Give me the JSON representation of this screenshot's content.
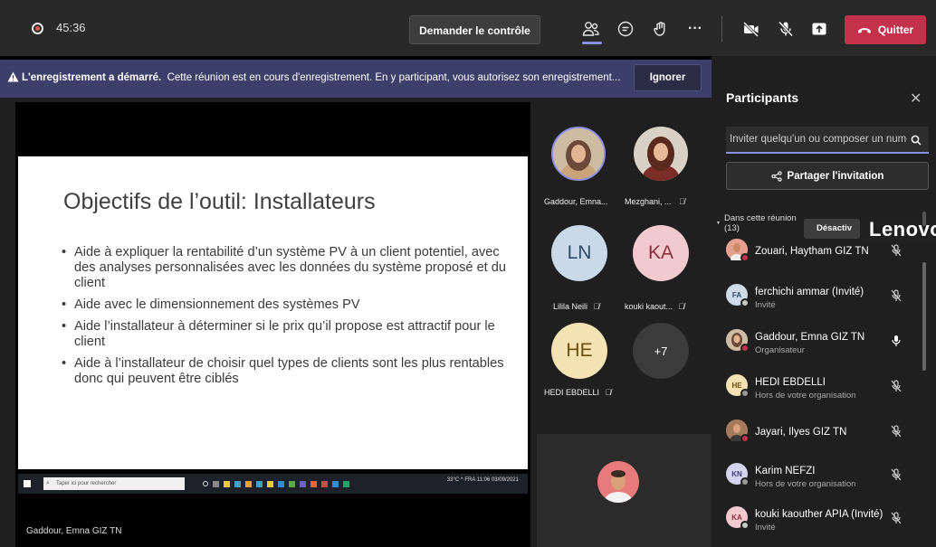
{
  "topbar": {
    "timer": "45:36",
    "request_control": "Demander le contrôle",
    "quit": "Quitter"
  },
  "banner": {
    "title": "L'enregistrement a démarré.",
    "message": "Cette réunion est en cours d'enregistrement. En y participant, vous autorisez son enregistrement...",
    "ignore": "Ignorer"
  },
  "slide": {
    "title": "Objectifs de l’outil: Installateurs",
    "bullets": [
      "Aide à expliquer la rentabilité d’un système PV à un client potentiel, avec des analyses personnalisées avec les données du système proposé et du client",
      "Aide avec le dimensionnement des systèmes PV",
      "Aide l’installateur à déterminer si le prix qu’il propose est attractif pour le client",
      "Aide à l’installateur de choisir quel types de clients sont les plus rentables donc qui peuvent être ciblés"
    ],
    "taskbar_search": "Taper ici pour rechercher",
    "taskbar_tray": "33°C  ^  FRA  11:06 03/09/2021"
  },
  "presenter_name": "Gaddour, Emna GIZ TN",
  "gallery": [
    {
      "name": "Gaddour, Emna...",
      "initials": "",
      "color": "#c9a37a"
    },
    {
      "name": "Mezghani, ...",
      "initials": "",
      "color": "#8c3b2e"
    },
    {
      "name": "Lilila Neili",
      "initials": "LN",
      "color": "#c9d9e8",
      "text": "#2f4a66"
    },
    {
      "name": "kouki kaout...",
      "initials": "KA",
      "color": "#f2c9cf",
      "text": "#8a2f3d"
    },
    {
      "name": "HEDI EBDELLI",
      "initials": "HE",
      "color": "#f5e2b3",
      "text": "#6b4f0e"
    },
    {
      "name": "",
      "initials": "+7",
      "color": "#3b3b3b",
      "text": "#ffffff"
    }
  ],
  "panel": {
    "title": "Participants",
    "invite_placeholder": "Inviter quelqu'un ou composer un numéro",
    "share_invite": "Partager l'invitation",
    "section": "Dans cette réunion (13)",
    "section_line1": "Dans cette réunion",
    "section_line2": "(13)",
    "deactivate": "Désactiv",
    "overlay_brand": "Lenovo",
    "participants": [
      {
        "name": "Zouari, Haytham GIZ TN",
        "role": "",
        "initials": "",
        "color": "#d98f80",
        "status": "#c4314b",
        "mic": "off"
      },
      {
        "name": "ferchichi ammar (Invité)",
        "role": "Invité",
        "initials": "FA",
        "color": "#cfdbe8",
        "status": "#c8c8c8",
        "mic": "off"
      },
      {
        "name": "Gaddour, Emna GIZ TN",
        "role": "Organisateur",
        "initials": "",
        "color": "#c9a37a",
        "status": "#c4314b",
        "mic": "on"
      },
      {
        "name": "HEDI EBDELLI",
        "role": "Hors de votre organisation",
        "initials": "HE",
        "color": "#f5e2b3",
        "status": "#999999",
        "mic": "off"
      },
      {
        "name": "Jayari, Ilyes GIZ TN",
        "role": "",
        "initials": "",
        "color": "#c48a5a",
        "status": "#c4314b",
        "mic": "off"
      },
      {
        "name": "Karim NEFZI",
        "role": "Hors de votre organisation",
        "initials": "KN",
        "color": "#d6d3ef",
        "status": "#999999",
        "mic": "off"
      },
      {
        "name": "kouki kaouther APIA (Invité)",
        "role": "Invité",
        "initials": "KA",
        "color": "#f2c9cf",
        "status": "#c8c8c8",
        "mic": "off"
      }
    ]
  }
}
